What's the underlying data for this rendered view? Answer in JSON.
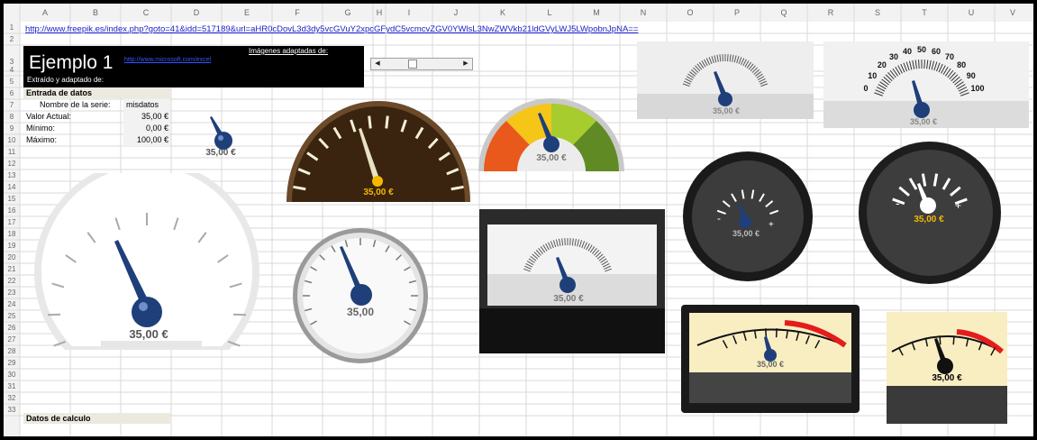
{
  "sheet": {
    "columns": [
      "A",
      "B",
      "C",
      "D",
      "E",
      "F",
      "G",
      "H",
      "I",
      "J",
      "K",
      "L",
      "M",
      "N",
      "O",
      "P",
      "Q",
      "R",
      "S",
      "T",
      "U",
      "V"
    ],
    "rows": [
      "1",
      "2",
      "3",
      "4",
      "5",
      "6",
      "7",
      "8",
      "9",
      "10",
      "11",
      "12",
      "13",
      "14",
      "15",
      "16",
      "17",
      "18",
      "19",
      "20",
      "21",
      "22",
      "23",
      "24",
      "25",
      "26",
      "27",
      "28",
      "29",
      "30",
      "31",
      "32",
      "33"
    ]
  },
  "cells": {
    "url": "http://www.freepik.es/index.php?goto=41&idd=517189&url=aHR0cDovL3d3dy5vcGVuY2xpcGFydC5vcmcvZGV0YWlsL3NwZWVkb21ldGVyLWJ5LWpobnJpNA==",
    "title": "Ejemplo 1",
    "adapted_from": "Extraído y adaptado de:",
    "source_link": "http://www.microsoft.com/excel",
    "images_adapted": "Imágenes adaptadas de:",
    "input_header": "Entrada de datos",
    "series_label": "Nombre de la serie:",
    "series_value": "misdatos",
    "current_label": "Valor Actual:",
    "current_value": "35,00 €",
    "min_label": "Mínimo:",
    "min_value": "0,00 €",
    "max_label": "Máximo:",
    "max_value": "100,00 €",
    "calc_header": "Datos de calculo"
  },
  "scrollbar": {
    "left_arrow": "◀",
    "right_arrow": "▶",
    "thumb_fraction": 0.35
  },
  "gauges": {
    "value_fraction": 0.35,
    "g1_label": "35,00 €",
    "g2_label": "35,00 €",
    "g3_label": "35,00 €",
    "g4_label": "35,00 €",
    "g5_label": "35,00 €",
    "g6_label": "35,00 €",
    "g7_label": "35,00",
    "g8_label": "35,00 €",
    "g9_label": "35,00 €",
    "g10_label": "35,00 €",
    "g11_label": "35,00 €",
    "g12_label": "35,00 €",
    "g6_ticks": [
      "0",
      "10",
      "20",
      "30",
      "40",
      "50",
      "60",
      "70",
      "80",
      "90",
      "100"
    ]
  },
  "colors": {
    "grid": "#d9d9d9",
    "header_bg": "#f2f2f2",
    "needle_blue": "#1f3f7a",
    "accent_orange": "#f5b800",
    "header_fill": "#ece9df",
    "red_zone": "#e51c1c"
  }
}
